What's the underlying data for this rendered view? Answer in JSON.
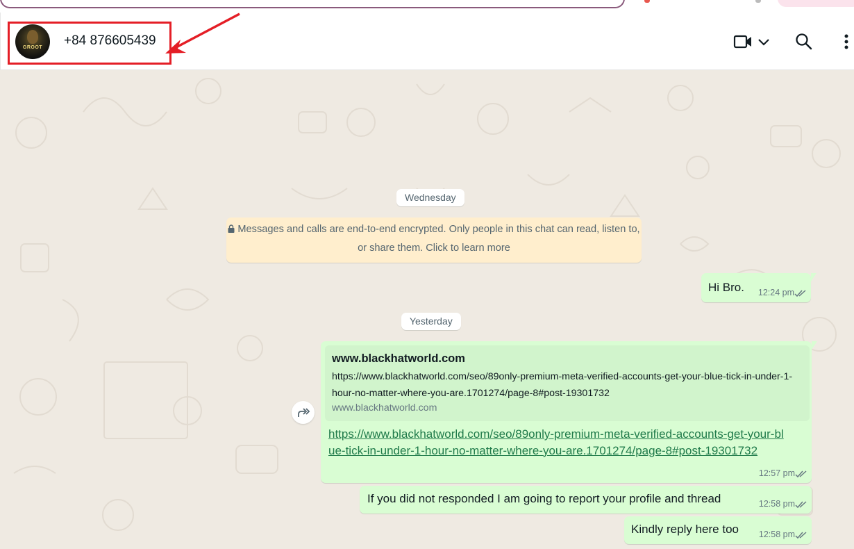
{
  "header": {
    "contact_name": "+84 876605439",
    "avatar_text": "GROOT"
  },
  "chat": {
    "date_chips": [
      "Wednesday",
      "Yesterday"
    ],
    "encryption_notice": "Messages and calls are end-to-end encrypted. Only people in this chat can read, listen to, or share them. Click to learn more",
    "messages": [
      {
        "text": "Hi Bro.",
        "time": "12:24 pm"
      },
      {
        "preview_title": "www.blackhatworld.com",
        "preview_description": "https://www.blackhatworld.com/seo/89only-premium-meta-verified-accounts-get-your-blue-tick-in-under-1-hour-no-matter-where-you-are.1701274/page-8#post-19301732",
        "preview_domain": "www.blackhatworld.com",
        "link": "https://www.blackhatworld.com/seo/89only-premium-meta-verified-accounts-get-your-blue-tick-in-under-1-hour-no-matter-where-you-are.1701274/page-8#post-19301732",
        "time": "12:57 pm"
      },
      {
        "text": "If you did not responded I am going to report your profile and thread",
        "time": "12:58 pm"
      },
      {
        "text": "Kindly reply here too",
        "time": "12:58 pm"
      }
    ]
  },
  "icons": [
    "video-call-icon",
    "chevron-down-icon",
    "search-icon",
    "menu-icon",
    "lock-icon",
    "forward-icon",
    "double-check-icon"
  ],
  "colors": {
    "outgoing_bubble": "#d9fdd3",
    "link_preview_bg": "#d1f4cc",
    "encryption_notice_bg": "#ffeecd",
    "wallpaper": "#efeae2",
    "highlight_annotation": "#e41e26",
    "read_ticks": "#667781"
  }
}
